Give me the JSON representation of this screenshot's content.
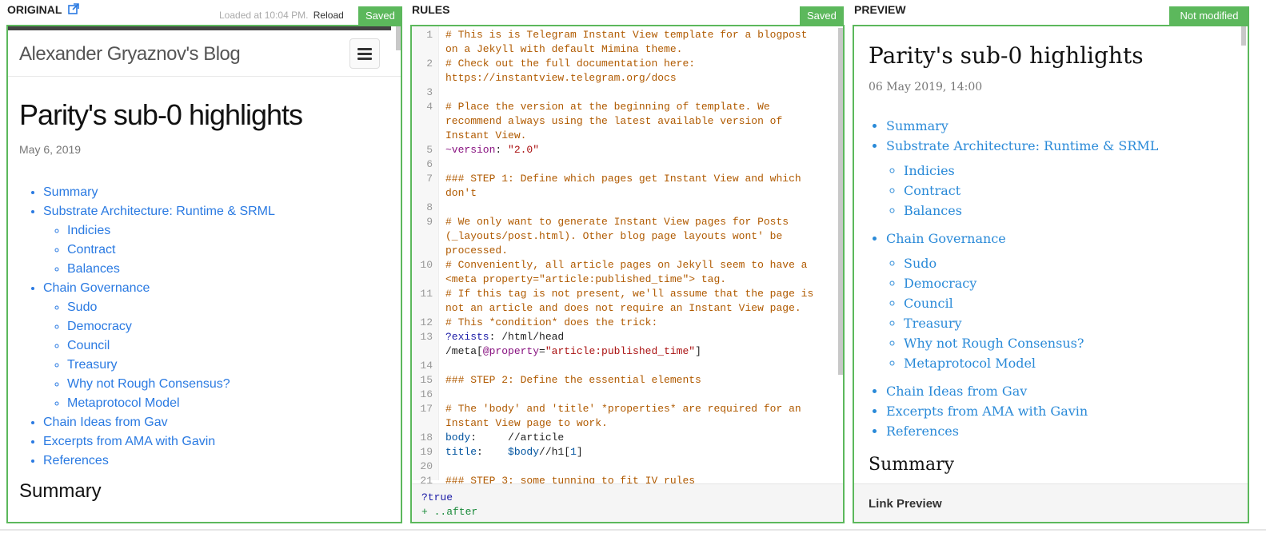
{
  "original": {
    "label": "ORIGINAL",
    "loaded_text": "Loaded at 10:04 PM.",
    "reload_label": "Reload",
    "status": "Saved",
    "site_title": "Alexander Gryaznov's Blog",
    "post_title": "Parity's sub-0 highlights",
    "post_date": "May 6, 2019",
    "toc": [
      {
        "label": "Summary",
        "children": []
      },
      {
        "label": "Substrate Architecture: Runtime & SRML",
        "children": [
          "Indicies",
          "Contract",
          "Balances"
        ]
      },
      {
        "label": "Chain Governance",
        "children": [
          "Sudo",
          "Democracy",
          "Council",
          "Treasury",
          "Why not Rough Consensus?",
          "Metaprotocol Model"
        ]
      },
      {
        "label": "Chain Ideas from Gav",
        "children": []
      },
      {
        "label": "Excerpts from AMA with Gavin",
        "children": []
      },
      {
        "label": "References",
        "children": []
      }
    ],
    "summary_heading": "Summary"
  },
  "rules": {
    "label": "RULES",
    "status": "Saved",
    "lines": [
      {
        "n": "1",
        "html": "<span class='cm'># This is is Telegram Instant View template for a blogpost on a Jekyll with default Mimina theme.</span>"
      },
      {
        "n": "2",
        "html": "<span class='cm'># Check out the full documentation here: https://instantview.telegram.org/docs</span>"
      },
      {
        "n": "3",
        "html": ""
      },
      {
        "n": "4",
        "html": "<span class='cm'># Place the version at the beginning of template. We recommend always using the latest available version of Instant View.</span>"
      },
      {
        "n": "5",
        "html": "<span class='at'>~version</span>: <span class='str'>\"2.0\"</span>"
      },
      {
        "n": "6",
        "html": ""
      },
      {
        "n": "7",
        "html": "<span class='cm'>### STEP 1: Define which pages get Instant View and which don't</span>"
      },
      {
        "n": "8",
        "html": ""
      },
      {
        "n": "9",
        "html": "<span class='cm'># We only want to generate Instant View pages for Posts (_layouts/post.html). Other blog page layouts wont' be processed.</span>"
      },
      {
        "n": "10",
        "html": "<span class='cm'># Conveniently, all article pages on Jekyll seem to have a &lt;meta property=\"article:published_time\"&gt; tag.</span>"
      },
      {
        "n": "11",
        "html": "<span class='cm'># If this tag is not present, we'll assume that the page is not an article and does not require an Instant View page.</span>"
      },
      {
        "n": "12",
        "html": "<span class='cm'># This *condition* does the trick:</span>"
      },
      {
        "n": "13",
        "html": "<span class='kw'>?exists</span>: /html/head /meta[<span class='at'>@property</span>=<span class='str'>\"article:published_time\"</span>]"
      },
      {
        "n": "14",
        "html": ""
      },
      {
        "n": "15",
        "html": "<span class='cm'>### STEP 2: Define the essential elements</span>"
      },
      {
        "n": "16",
        "html": ""
      },
      {
        "n": "17",
        "html": "<span class='cm'># The 'body' and 'title' *properties* are required for an Instant View page to work.</span>"
      },
      {
        "n": "18",
        "html": "<span class='vr'>body</span>:     //article"
      },
      {
        "n": "19",
        "html": "<span class='vr'>title</span>:    <span class='vr'>$body</span>//h1[<span class='vr'>1</span>]"
      },
      {
        "n": "20",
        "html": ""
      },
      {
        "n": "21",
        "html": "<span class='cm'>### STEP 3: some tunning to fit IV rules</span>"
      }
    ],
    "footer_lines": [
      "?true",
      "+ ..after"
    ]
  },
  "preview": {
    "label": "PREVIEW",
    "status": "Not modified",
    "post_title": "Parity's sub-0 highlights",
    "post_date": "06 May 2019, 14:00",
    "toc": [
      {
        "label": "Summary",
        "children": []
      },
      {
        "label": "Substrate Architecture: Runtime & SRML",
        "children": [
          "Indicies",
          "Contract",
          "Balances"
        ]
      },
      {
        "label": "Chain Governance",
        "children": [
          "Sudo",
          "Democracy",
          "Council",
          "Treasury",
          "Why not Rough Consensus?",
          "Metaprotocol Model"
        ]
      },
      {
        "label": "Chain Ideas from Gav",
        "children": []
      },
      {
        "label": "Excerpts from AMA with Gavin",
        "children": []
      },
      {
        "label": "References",
        "children": []
      }
    ],
    "summary_heading": "Summary",
    "link_preview_label": "Link Preview"
  },
  "colors": {
    "panel_border": "#5cb85c",
    "link": "#2a7ae2",
    "comment": "#b05a00"
  }
}
